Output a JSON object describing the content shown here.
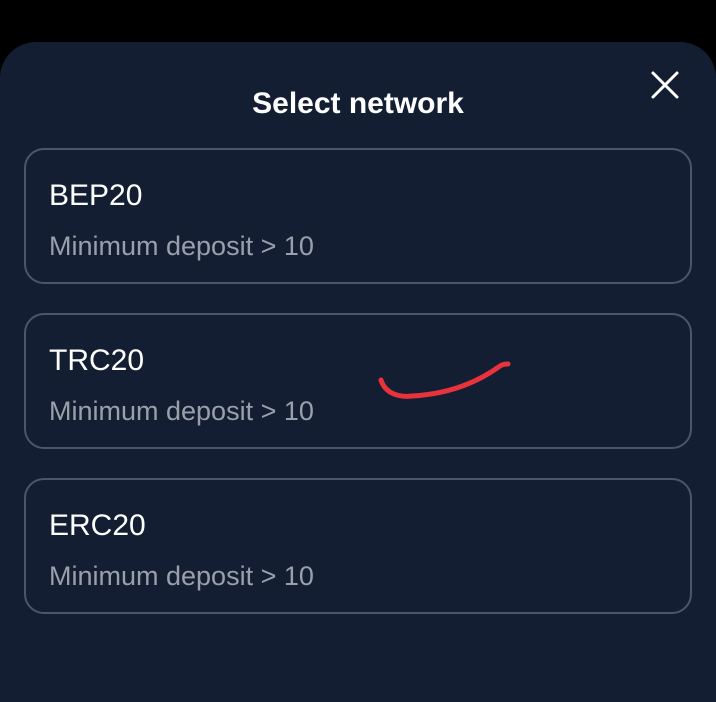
{
  "sheet": {
    "title": "Select network",
    "close_icon": "close-icon"
  },
  "networks": [
    {
      "name": "BEP20",
      "min_deposit": "Minimum deposit > 10"
    },
    {
      "name": "TRC20",
      "min_deposit": "Minimum deposit > 10"
    },
    {
      "name": "ERC20",
      "min_deposit": "Minimum deposit > 10"
    }
  ],
  "colors": {
    "sheet_background": "#141e33",
    "card_border": "#4c5669",
    "title_text": "#ffffff",
    "secondary_text": "#9aa0aa",
    "annotation_stroke": "#e8323c"
  }
}
